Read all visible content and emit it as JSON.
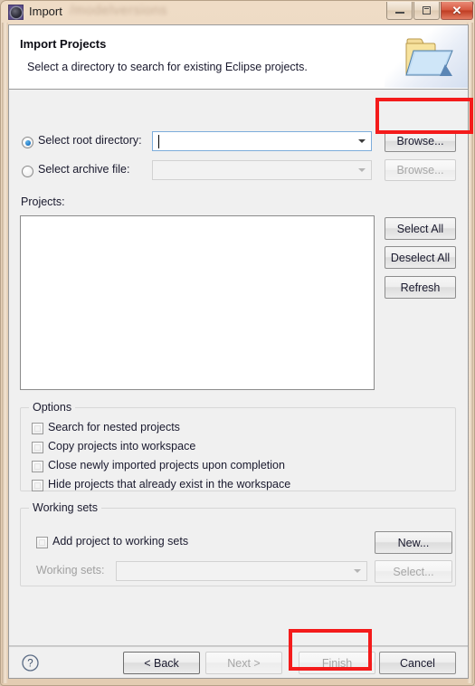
{
  "window": {
    "title": "Import",
    "blurred_background_text": "/modelversions",
    "app_icon": "eclipse-import-icon",
    "controls": {
      "minimize": "minimize-icon",
      "maximize": "maximize-icon",
      "close": "✕"
    }
  },
  "header": {
    "title": "Import Projects",
    "subtitle": "Select a directory to search for existing Eclipse projects.",
    "banner_icon": "open-folder-icon"
  },
  "source": {
    "root_directory": {
      "radio_label": "Select root directory:",
      "selected": true,
      "value": "",
      "browse_label": "Browse..."
    },
    "archive_file": {
      "radio_label": "Select archive file:",
      "selected": false,
      "value": "",
      "browse_label": "Browse..."
    }
  },
  "projects": {
    "label": "Projects:",
    "items": [],
    "buttons": {
      "select_all": "Select All",
      "deselect_all": "Deselect All",
      "refresh": "Refresh"
    }
  },
  "options": {
    "group_title": "Options",
    "checkboxes": [
      {
        "label": "Search for nested projects",
        "checked": false
      },
      {
        "label": "Copy projects into workspace",
        "checked": false
      },
      {
        "label": "Close newly imported projects upon completion",
        "checked": false
      },
      {
        "label": "Hide projects that already exist in the workspace",
        "checked": false
      }
    ]
  },
  "working_sets": {
    "group_title": "Working sets",
    "add_checkbox": {
      "label": "Add project to working sets",
      "checked": false
    },
    "new_button": "New...",
    "sets_label": "Working sets:",
    "sets_value": "",
    "select_button": "Select..."
  },
  "buttonbar": {
    "help": "?",
    "back": "< Back",
    "next": "Next >",
    "finish": "Finish",
    "cancel": "Cancel"
  },
  "annotations": {
    "highlight_color": "#f41b1b",
    "boxes": [
      "browse-root-directory-button",
      "finish-button"
    ]
  }
}
